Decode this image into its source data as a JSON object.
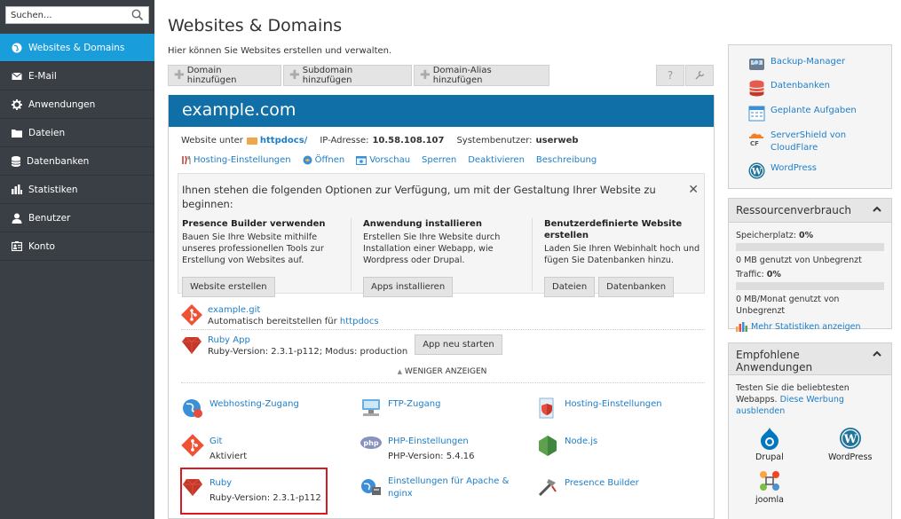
{
  "sidebar": {
    "search_placeholder": "Suchen...",
    "items": [
      {
        "label": "Websites & Domains",
        "icon": "globe-icon",
        "active": true
      },
      {
        "label": "E-Mail",
        "icon": "mail-icon"
      },
      {
        "label": "Anwendungen",
        "icon": "gear-icon"
      },
      {
        "label": "Dateien",
        "icon": "folder-icon"
      },
      {
        "label": "Datenbanken",
        "icon": "database-icon"
      },
      {
        "label": "Statistiken",
        "icon": "bar-chart-icon"
      },
      {
        "label": "Benutzer",
        "icon": "user-icon"
      },
      {
        "label": "Konto",
        "icon": "id-card-icon"
      }
    ]
  },
  "main": {
    "title": "Websites & Domains",
    "description": "Hier können Sie Websites erstellen und verwalten.",
    "toolbar": {
      "add_domain": "Domain hinzufügen",
      "add_subdomain": "Subdomain hinzufügen",
      "add_alias": "Domain-Alias hinzufügen",
      "help": "?"
    }
  },
  "domain": {
    "name": "example.com",
    "website_under_label": "Website unter",
    "docroot": "httpdocs/",
    "ip_label": "IP-Adresse:",
    "ip": "10.58.108.107",
    "sysuser_label": "Systembenutzer:",
    "sysuser": "userweb",
    "actions": [
      "Hosting-Einstellungen",
      "Öffnen",
      "Vorschau",
      "Sperren",
      "Deaktivieren",
      "Beschreibung"
    ],
    "options_intro": "Ihnen stehen die folgenden Optionen zur Verfügung, um mit der Gestaltung Ihrer Website zu beginnen:",
    "options": [
      {
        "title": "Presence Builder verwenden",
        "text": "Bauen Sie Ihre Website mithilfe unseres professionellen Tools zur Erstellung von Websites auf.",
        "buttons": [
          "Website erstellen"
        ]
      },
      {
        "title": "Anwendung installieren",
        "text": "Erstellen Sie Ihre Website durch Installation einer Webapp, wie Wordpress oder Drupal.",
        "buttons": [
          "Apps installieren"
        ]
      },
      {
        "title": "Benutzerdefinierte Website erstellen",
        "text": "Laden Sie Ihren Webinhalt hoch und fügen Sie Datenbanken hinzu.",
        "buttons": [
          "Dateien",
          "Datenbanken"
        ]
      }
    ],
    "git": {
      "name": "example.git",
      "desc_prefix": "Automatisch bereitstellen für",
      "desc_link": "httpdocs"
    },
    "ruby_app": {
      "name": "Ruby App",
      "desc": "Ruby-Version: 2.3.1-p112; Modus: production",
      "restart": "App neu starten"
    },
    "show_less": "WENIGER ANZEIGEN",
    "tiles": [
      {
        "name": "Webhosting-Zugang",
        "sub": ""
      },
      {
        "name": "FTP-Zugang",
        "sub": ""
      },
      {
        "name": "Hosting-Einstellungen",
        "sub": ""
      },
      {
        "name": "Git",
        "sub": "Aktiviert"
      },
      {
        "name": "PHP-Einstellungen",
        "sub": "PHP-Version: 5.4.16"
      },
      {
        "name": "Node.js",
        "sub": ""
      },
      {
        "name": "Ruby",
        "sub": "Ruby-Version: 2.3.1-p112"
      },
      {
        "name": "Einstellungen für Apache & nginx",
        "sub": ""
      },
      {
        "name": "Presence Builder",
        "sub": ""
      }
    ]
  },
  "right": {
    "links": [
      "Backup-Manager",
      "Datenbanken",
      "Geplante Aufgaben",
      "ServerShield von CloudFlare",
      "WordPress"
    ],
    "resources": {
      "title": "Ressourcenverbrauch",
      "storage_label": "Speicherplatz:",
      "storage_value": "0%",
      "storage_detail": "0 MB genutzt von Unbegrenzt",
      "traffic_label": "Traffic:",
      "traffic_value": "0%",
      "traffic_detail": "0 MB/Monat genutzt von Unbegrenzt",
      "more_stats": "Mehr Statistiken anzeigen"
    },
    "recommended": {
      "title": "Empfohlene Anwendungen",
      "text": "Testen Sie die beliebtesten Webapps.",
      "link": "Diese Werbung ausblenden",
      "apps": [
        "Drupal",
        "WordPress",
        "joomla"
      ]
    }
  },
  "colors": {
    "accent": "#1a9ddb",
    "domain_header": "#0f6fa6",
    "sidebar": "#3a3f45",
    "highlight": "#d51b24"
  }
}
